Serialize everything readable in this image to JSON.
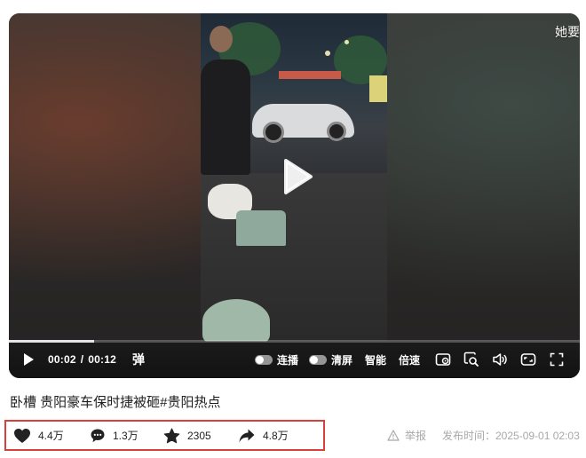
{
  "player": {
    "overlay_text": "她要",
    "time": {
      "current": "00:02",
      "total": "00:12"
    },
    "progress": 0.15,
    "danmu_label": "弹",
    "continuous_label": "连播",
    "clear_screen_label": "清屏",
    "quality_label": "智能",
    "speed_label": "倍速"
  },
  "video": {
    "title": "卧槽 贵阳豪车保时捷被砸#贵阳热点"
  },
  "actions": {
    "likes": "4.4万",
    "comments": "1.3万",
    "favorites": "2305",
    "shares": "4.8万"
  },
  "meta": {
    "report_label": "举报",
    "publish_label": "发布时间：2025-09-01 02:03"
  },
  "colors": {
    "highlight_border": "#d9403b",
    "text_dark": "#222222",
    "text_muted": "#a8a8a8"
  }
}
